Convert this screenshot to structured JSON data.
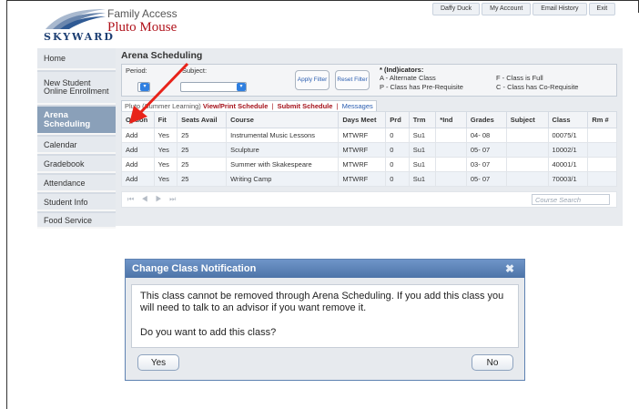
{
  "header": {
    "logo_text": "SKYWARD",
    "app_title": "Family Access",
    "user_name": "Pluto Mouse",
    "links": [
      "Daffy Duck",
      "My Account",
      "Email History",
      "Exit"
    ]
  },
  "sidebar": {
    "items": [
      {
        "label": "Home"
      },
      {
        "label": "New Student Online Enrollment"
      },
      {
        "label": "Arena Scheduling"
      },
      {
        "label": "Calendar"
      },
      {
        "label": "Gradebook"
      },
      {
        "label": "Attendance"
      },
      {
        "label": "Student Info"
      },
      {
        "label": "Food Service"
      }
    ],
    "active_index": 2
  },
  "main": {
    "title": "Arena Scheduling",
    "filters": {
      "period_label": "Period:",
      "subject_label": "Subject:",
      "apply_label": "Apply Filter",
      "reset_label": "Reset Filter"
    },
    "indicators": {
      "title": "* (Ind)icators:",
      "items": [
        "A - Alternate Class",
        "P - Class has Pre-Requisite",
        "F - Class is Full",
        "C - Class has Co-Requisite"
      ]
    },
    "tabs": {
      "term": "Pluto (Summer Learning)",
      "view_print": "View/Print Schedule",
      "submit": "Submit Schedule",
      "messages": "Messages"
    },
    "table": {
      "columns": [
        "Option",
        "Fit",
        "Seats Avail",
        "Course",
        "Days Meet",
        "Prd",
        "Trm",
        "*Ind",
        "Grades",
        "Subject",
        "Class",
        "Rm #"
      ],
      "rows": [
        {
          "option": "Add",
          "fit": "Yes",
          "seats": "25",
          "course": "Instrumental Music Lessons",
          "days": "MTWRF",
          "prd": "0",
          "trm": "Su1",
          "ind": "",
          "grades": "04- 08",
          "subject": "",
          "class": "00075/1",
          "rm": ""
        },
        {
          "option": "Add",
          "fit": "Yes",
          "seats": "25",
          "course": "Sculpture",
          "days": "MTWRF",
          "prd": "0",
          "trm": "Su1",
          "ind": "",
          "grades": "05- 07",
          "subject": "",
          "class": "10002/1",
          "rm": ""
        },
        {
          "option": "Add",
          "fit": "Yes",
          "seats": "25",
          "course": "Summer with Skakespeare",
          "days": "MTWRF",
          "prd": "0",
          "trm": "Su1",
          "ind": "",
          "grades": "03- 07",
          "subject": "",
          "class": "40001/1",
          "rm": ""
        },
        {
          "option": "Add",
          "fit": "Yes",
          "seats": "25",
          "course": "Writing Camp",
          "days": "MTWRF",
          "prd": "0",
          "trm": "Su1",
          "ind": "",
          "grades": "05- 07",
          "subject": "",
          "class": "70003/1",
          "rm": ""
        }
      ]
    },
    "pager": {
      "controls": "⏮ ◀ ▶ ⏭",
      "search_placeholder": "Course Search"
    }
  },
  "dialog": {
    "title": "Change Class Notification",
    "message": "This class cannot be removed through Arena Scheduling. If you add this class you will need to talk to an advisor if you want remove it.",
    "question": "Do you want to add this class?",
    "yes_label": "Yes",
    "no_label": "No",
    "close_icon": "close-icon"
  },
  "colors": {
    "brand_blue": "#1d3f73",
    "brand_red": "#b0121b",
    "link_blue": "#2a5db0",
    "fit_green": "#2e8b57",
    "nav_active": "#8aa0b9",
    "dialog_header": "#5e82b2",
    "annotation_arrow": "#e8231a"
  }
}
